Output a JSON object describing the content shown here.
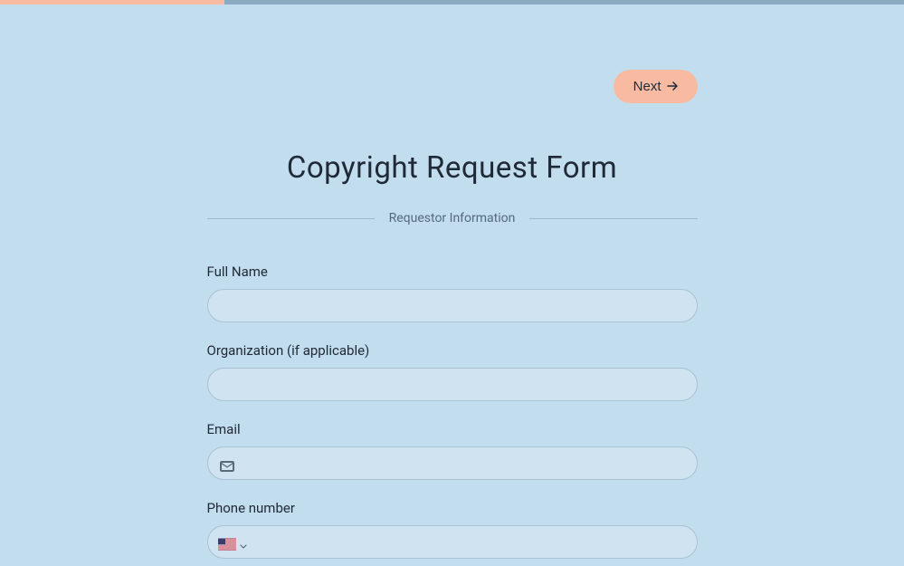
{
  "progress": {
    "percent": 25
  },
  "navigation": {
    "next_label": "Next"
  },
  "form": {
    "title": "Copyright Request Form",
    "section_label": "Requestor Information",
    "fields": {
      "full_name": {
        "label": "Full Name",
        "value": ""
      },
      "organization": {
        "label": "Organization (if applicable)",
        "value": ""
      },
      "email": {
        "label": "Email",
        "value": ""
      },
      "phone": {
        "label": "Phone number",
        "value": "",
        "country": "US"
      }
    }
  }
}
